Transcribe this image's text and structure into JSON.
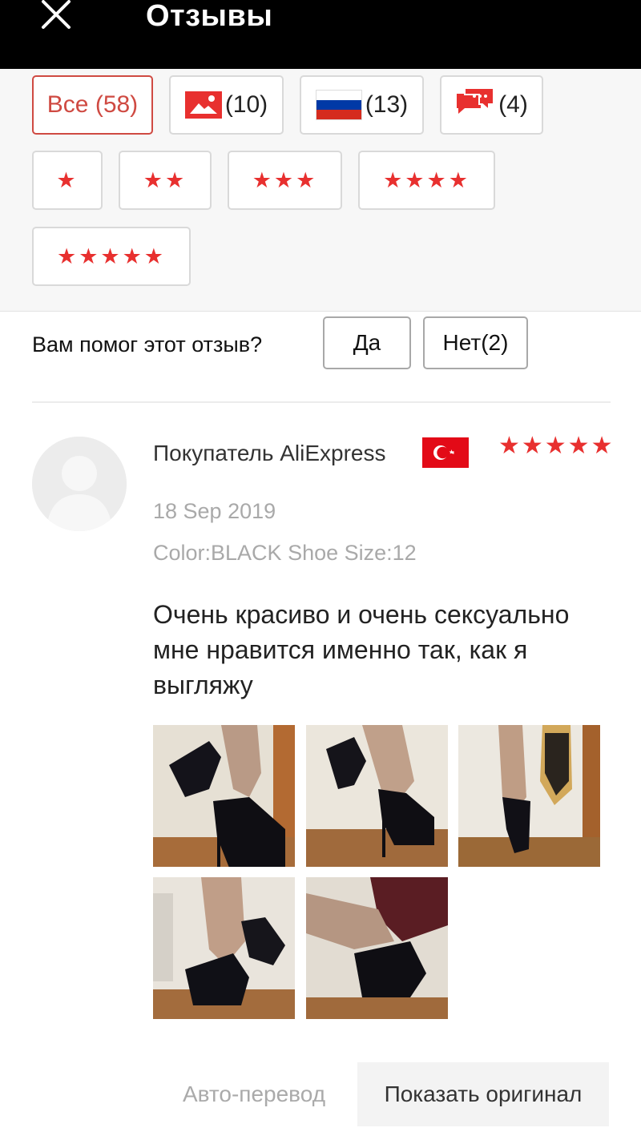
{
  "header": {
    "title": "Отзывы",
    "close_icon": "close-icon"
  },
  "filters": {
    "all": {
      "label": "Все (58)"
    },
    "photo": {
      "icon": "photo-icon",
      "count": "(10)"
    },
    "country": {
      "icon": "russia-flag-icon",
      "count": "(13)"
    },
    "comments": {
      "icon": "chat-icon",
      "count": "(4)"
    },
    "star_chips": [
      "★",
      "★★",
      "★★★",
      "★★★★",
      "★★★★★"
    ]
  },
  "helpful": {
    "question": "Вам помог этот отзыв?",
    "yes": "Да",
    "no": "Нет(2)"
  },
  "review": {
    "reviewer": "Покупатель AliExpress",
    "country_flag": "turkey-flag-icon",
    "rating": 5,
    "rating_stars": "★★★★★",
    "date": "18 Sep 2019",
    "attributes": "Color:BLACK Shoe Size:12",
    "text": "Очень красиво и очень сексуально мне нравится именно так, как я выгляжу",
    "photo_count": 5
  },
  "translation": {
    "auto": "Авто-перевод",
    "original": "Показать оригинал"
  },
  "colors": {
    "accent": "#e8302f",
    "active_border": "#cf4a42",
    "header_bg": "#000000"
  }
}
